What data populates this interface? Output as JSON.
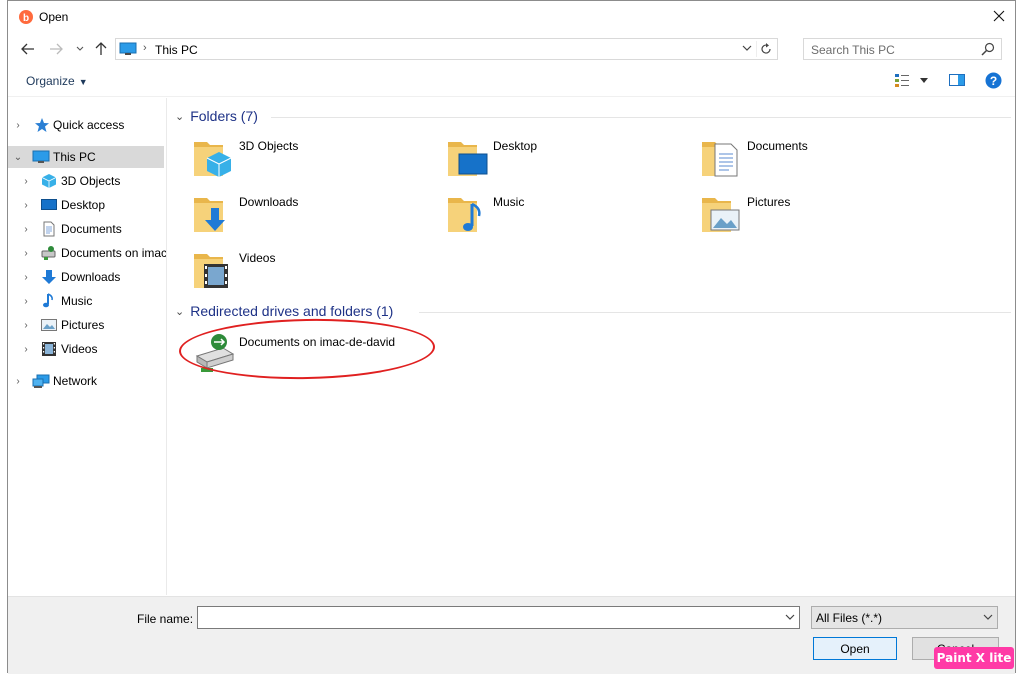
{
  "window": {
    "title": "Open"
  },
  "address": {
    "path": "This PC",
    "search_placeholder": "Search This PC"
  },
  "toolbar": {
    "organize_label": "Organize"
  },
  "nav": {
    "items": [
      {
        "label": "Quick access"
      },
      {
        "label": "This PC"
      },
      {
        "label": "3D Objects"
      },
      {
        "label": "Desktop"
      },
      {
        "label": "Documents"
      },
      {
        "label": "Documents on imac-de-david"
      },
      {
        "label": "Downloads"
      },
      {
        "label": "Music"
      },
      {
        "label": "Pictures"
      },
      {
        "label": "Videos"
      },
      {
        "label": "Network"
      }
    ]
  },
  "content": {
    "folders_header": "Folders (7)",
    "folders": [
      {
        "label": "3D Objects",
        "icon": "3d-objects-folder-icon"
      },
      {
        "label": "Desktop",
        "icon": "desktop-folder-icon"
      },
      {
        "label": "Documents",
        "icon": "documents-folder-icon"
      },
      {
        "label": "Downloads",
        "icon": "downloads-folder-icon"
      },
      {
        "label": "Music",
        "icon": "music-folder-icon"
      },
      {
        "label": "Pictures",
        "icon": "pictures-folder-icon"
      },
      {
        "label": "Videos",
        "icon": "videos-folder-icon"
      }
    ],
    "redirected_header": "Redirected drives and folders (1)",
    "redirected": [
      {
        "label": "Documents on imac-de-david",
        "icon": "network-drive-icon"
      }
    ],
    "annotation_color": "#e02020"
  },
  "bottom": {
    "file_name_label": "File name:",
    "file_name_value": "",
    "filter_value": "All Files (*.*)",
    "open_label": "Open",
    "cancel_label": "Cancel"
  },
  "watermark": {
    "text": "Paint X lite",
    "color": "#ff3aa6"
  },
  "colors": {
    "accent": "#0078d7",
    "group_header": "#1e3287",
    "folder": "#f6d27a"
  }
}
